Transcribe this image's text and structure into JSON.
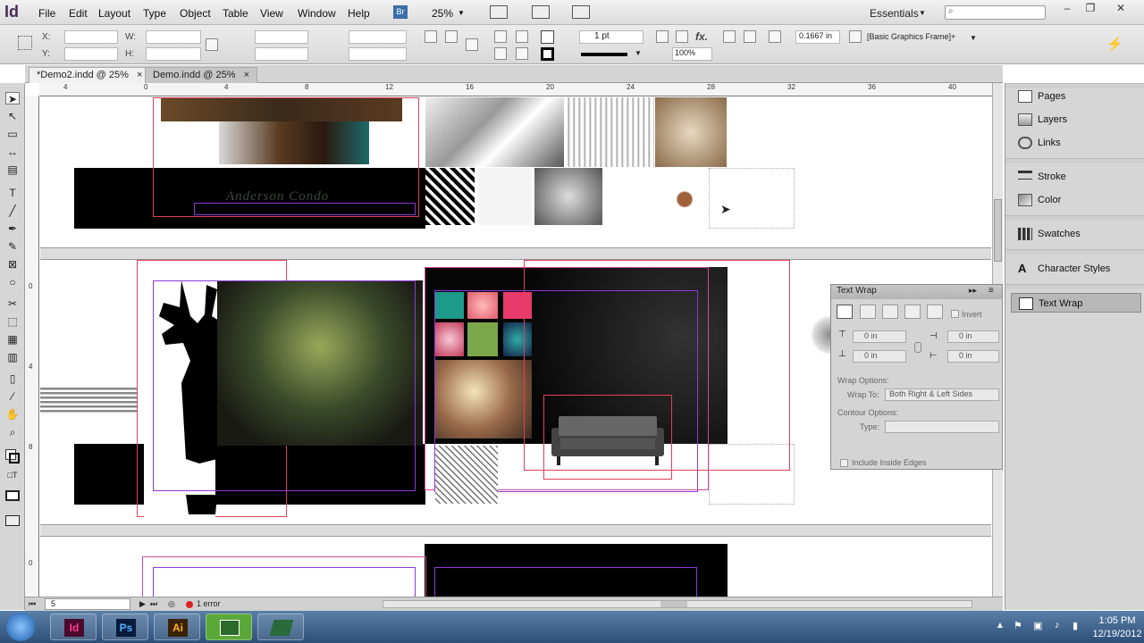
{
  "menubar": {
    "logo": "Id",
    "items": [
      "File",
      "Edit",
      "Layout",
      "Type",
      "Object",
      "Table",
      "View",
      "Window",
      "Help"
    ],
    "br_label": "Br",
    "zoom": "25%",
    "workspace": "Essentials",
    "window_controls": {
      "minimize": "–",
      "restore": "❐",
      "close": "✕"
    }
  },
  "control": {
    "x_label": "X:",
    "y_label": "Y:",
    "w_label": "W:",
    "h_label": "H:",
    "stroke_weight": "1 pt",
    "wrap_offset": "0.1667 in",
    "scale": "100%",
    "object_style": "[Basic Graphics Frame]+"
  },
  "tabs": [
    {
      "label": "*Demo2.indd @ 25%",
      "active": true
    },
    {
      "label": "Demo.indd @ 25%",
      "active": false
    }
  ],
  "ruler": {
    "h_ticks": [
      "4",
      "0",
      "4",
      "8",
      "12",
      "16",
      "20",
      "24",
      "28",
      "32",
      "36",
      "40"
    ],
    "v_ticks": [
      "0",
      "4",
      "8",
      "0"
    ]
  },
  "canvas": {
    "spread_text": "Anderson Condo"
  },
  "dock": {
    "items": [
      {
        "label": "Pages",
        "icon": "pages-icon"
      },
      {
        "label": "Layers",
        "icon": "layers-icon"
      },
      {
        "label": "Links",
        "icon": "links-icon"
      },
      {
        "label": "Stroke",
        "icon": "stroke-icon"
      },
      {
        "label": "Color",
        "icon": "color-icon"
      },
      {
        "label": "Swatches",
        "icon": "swatches-icon"
      },
      {
        "label": "Character Styles",
        "icon": "character-styles-icon"
      },
      {
        "label": "Text Wrap",
        "icon": "text-wrap-icon",
        "active": true
      }
    ]
  },
  "textwrap": {
    "title": "Text Wrap",
    "invert": "Invert",
    "top_offset": "0 in",
    "bottom_offset": "0 in",
    "left_offset": "0 in",
    "right_offset": "0 in",
    "wrap_options": "Wrap Options:",
    "wrap_to_label": "Wrap To:",
    "wrap_to_value": "Both Right & Left Sides",
    "contour_options": "Contour Options:",
    "type_label": "Type:",
    "include_inside_edges": "Include Inside Edges"
  },
  "status": {
    "page": "5",
    "errors": "1 error"
  },
  "taskbar": {
    "apps": [
      {
        "label": "Id",
        "name": "indesign-taskbar-button",
        "color": "#d2127a"
      },
      {
        "label": "Ps",
        "name": "photoshop-taskbar-button",
        "color": "#1d6fc9"
      },
      {
        "label": "Ai",
        "name": "illustrator-taskbar-button",
        "color": "#e8a000"
      }
    ],
    "time": "1:05 PM",
    "date": "12/19/2012"
  }
}
